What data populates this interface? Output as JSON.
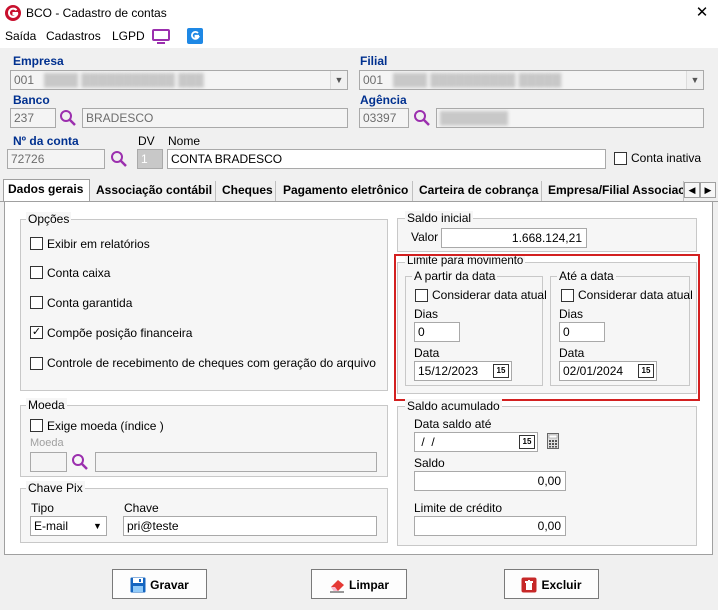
{
  "window": {
    "title": "BCO - Cadastro de contas",
    "close": "✕"
  },
  "menu": {
    "items": [
      "Saída",
      "Cadastros",
      "LGPD"
    ]
  },
  "header": {
    "empresa_label": "Empresa",
    "empresa_value": "001",
    "filial_label": "Filial",
    "filial_value": "001",
    "banco_label": "Banco",
    "banco_code": "237",
    "banco_name": "BRADESCO",
    "agencia_label": "Agência",
    "agencia_code": "03397",
    "numconta_label": "Nº da conta",
    "numconta_value": "72726",
    "dv_label": "DV",
    "dv_value": "1",
    "nome_label": "Nome",
    "nome_value": "CONTA BRADESCO",
    "conta_inativa_label": "Conta inativa"
  },
  "tabs": [
    "Dados gerais",
    "Associação contábil",
    "Cheques",
    "Pagamento eletrônico",
    "Carteira de cobrança",
    "Empresa/Filial Associac"
  ],
  "opcoes": {
    "title": "Opções",
    "items": [
      {
        "label": "Exibir em relatórios",
        "checked": false
      },
      {
        "label": "Conta caixa",
        "checked": false
      },
      {
        "label": "Conta garantida",
        "checked": false
      },
      {
        "label": "Compõe posição financeira",
        "checked": true
      },
      {
        "label": "Controle de recebimento de cheques com geração do arquivo",
        "checked": false
      }
    ]
  },
  "moeda": {
    "title": "Moeda",
    "exige_label": "Exige moeda (índice )",
    "moeda_label": "Moeda"
  },
  "pix": {
    "title": "Chave Pix",
    "tipo_label": "Tipo",
    "tipo_value": "E-mail",
    "chave_label": "Chave",
    "chave_value": "pri@teste"
  },
  "saldo_inicial": {
    "title": "Saldo inicial",
    "valor_label": "Valor",
    "valor_value": "1.668.124,21"
  },
  "limite": {
    "title": "Limite para movimento",
    "apartir": {
      "title": "A partir da data",
      "considerar_label": "Considerar data atual",
      "dias_label": "Dias",
      "dias_value": "0",
      "data_label": "Data",
      "data_value": "15/12/2023"
    },
    "ate": {
      "title": "Até a data",
      "considerar_label": "Considerar data atual",
      "dias_label": "Dias",
      "dias_value": "0",
      "data_label": "Data",
      "data_value": "02/01/2024"
    },
    "highlight_color": "#d32020"
  },
  "saldo_acumulado": {
    "title": "Saldo acumulado",
    "data_label": "Data saldo até",
    "data_value": " /  /",
    "saldo_label": "Saldo",
    "saldo_value": "0,00",
    "limite_label": "Limite de crédito",
    "limite_value": "0,00"
  },
  "calendar_icon_text": "15",
  "buttons": {
    "gravar": "Gravar",
    "limpar": "Limpar",
    "excluir": "Excluir"
  },
  "colors": {
    "label_blue": "#00308f",
    "accent_magenta": "#9b2fae",
    "logo_red": "#c8102e"
  }
}
